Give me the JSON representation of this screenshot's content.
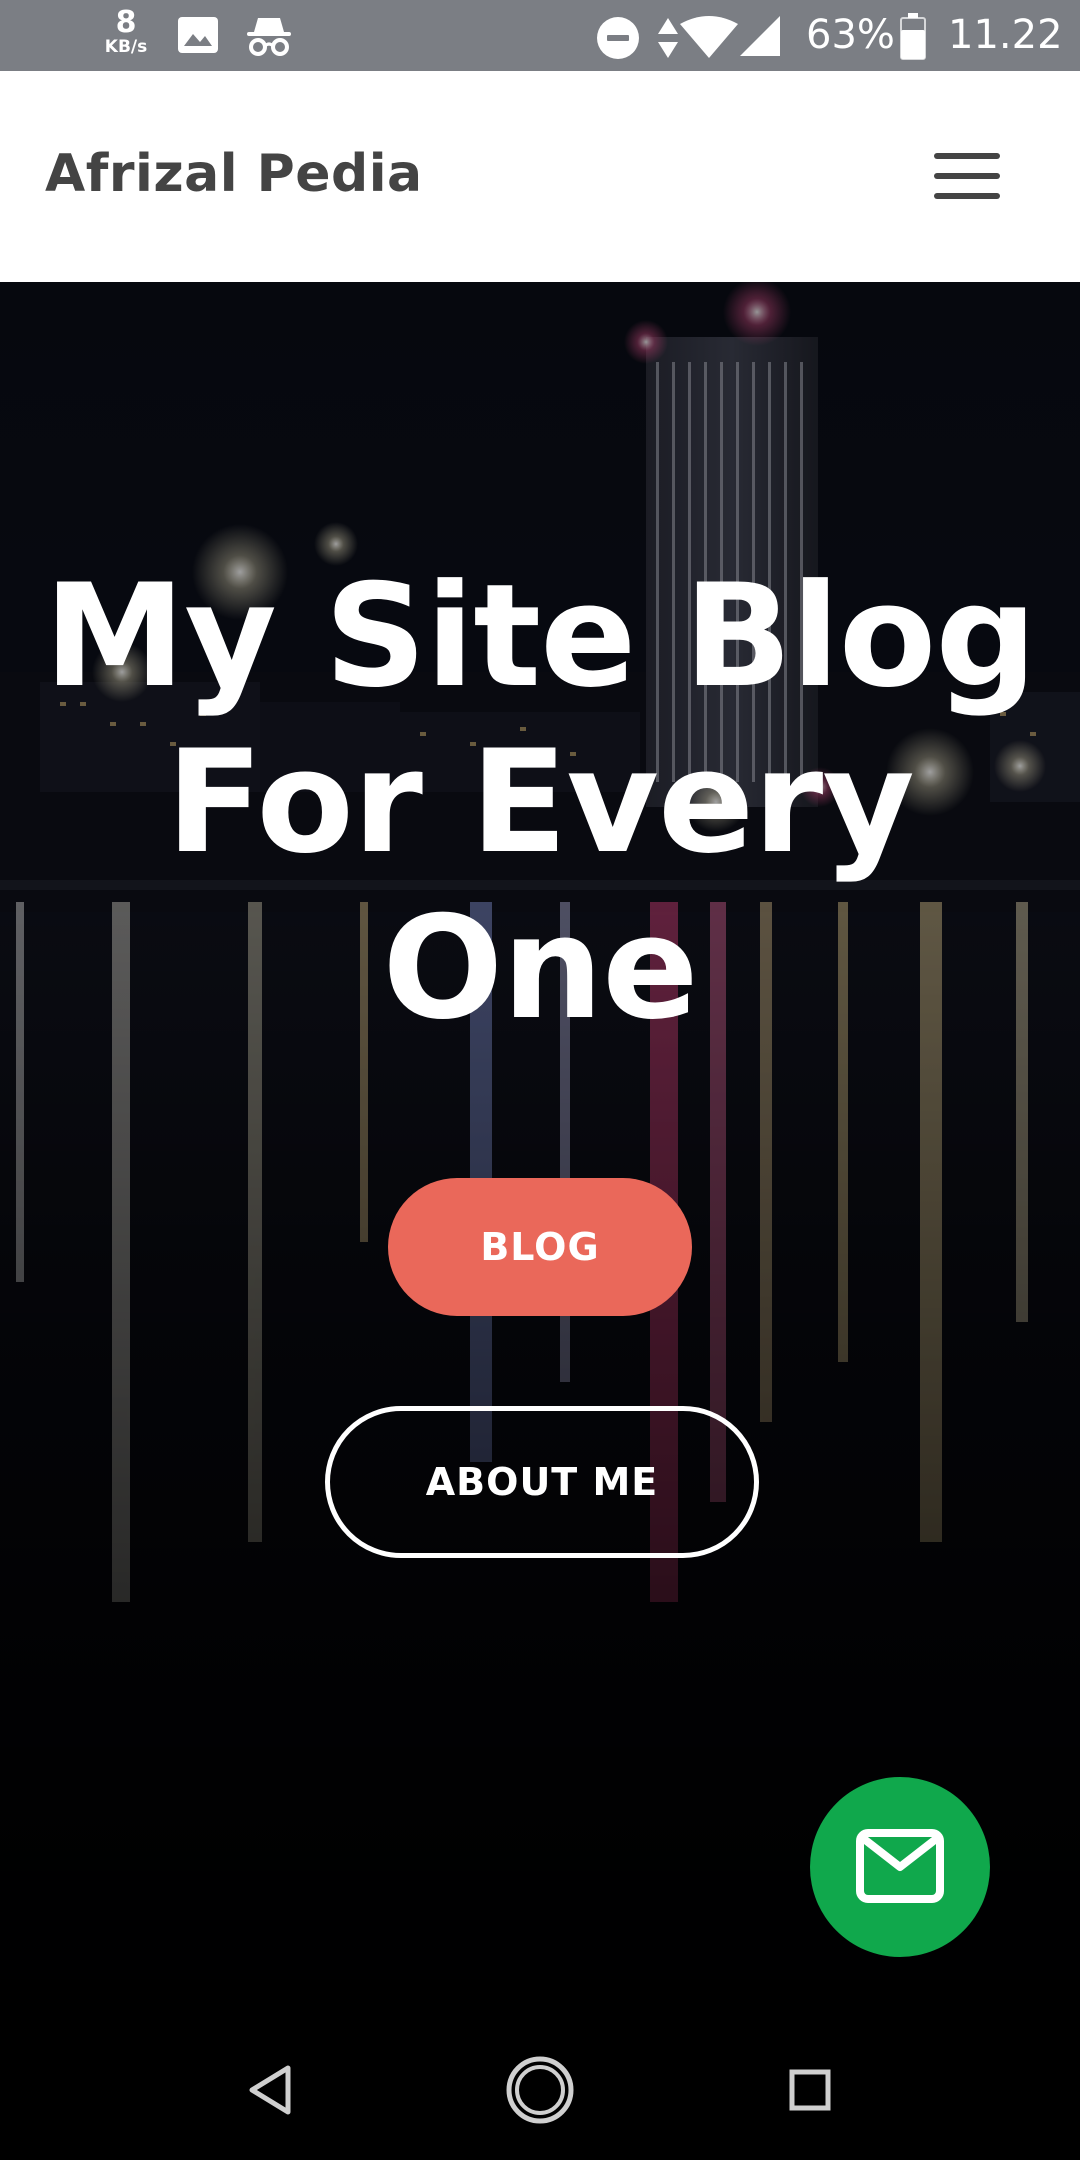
{
  "status_bar": {
    "net_speed_value": "8",
    "net_speed_unit": "KB/s",
    "battery_percent": "63%",
    "time": "11.22",
    "icons": [
      "image-icon",
      "incognito-icon",
      "do-not-disturb-icon",
      "data-arrows-icon",
      "wifi-icon",
      "signal-icon",
      "battery-icon"
    ]
  },
  "header": {
    "brand": "Afrizal Pedia",
    "menu_icon": "hamburger-menu-icon"
  },
  "hero": {
    "title": "My Site Blog For Every One",
    "blog_button": "BLOG",
    "about_button": "ABOUT ME",
    "fab_icon": "mail-icon"
  },
  "nav_bar": {
    "icons": [
      "back-icon",
      "home-icon",
      "recents-icon"
    ]
  },
  "colors": {
    "status_bar_bg": "#7b7e84",
    "header_bg": "#ffffff",
    "brand_text": "#444444",
    "blog_button_bg": "#ea685a",
    "fab_bg": "#10a84c",
    "hero_bg": "#0b0d16"
  }
}
